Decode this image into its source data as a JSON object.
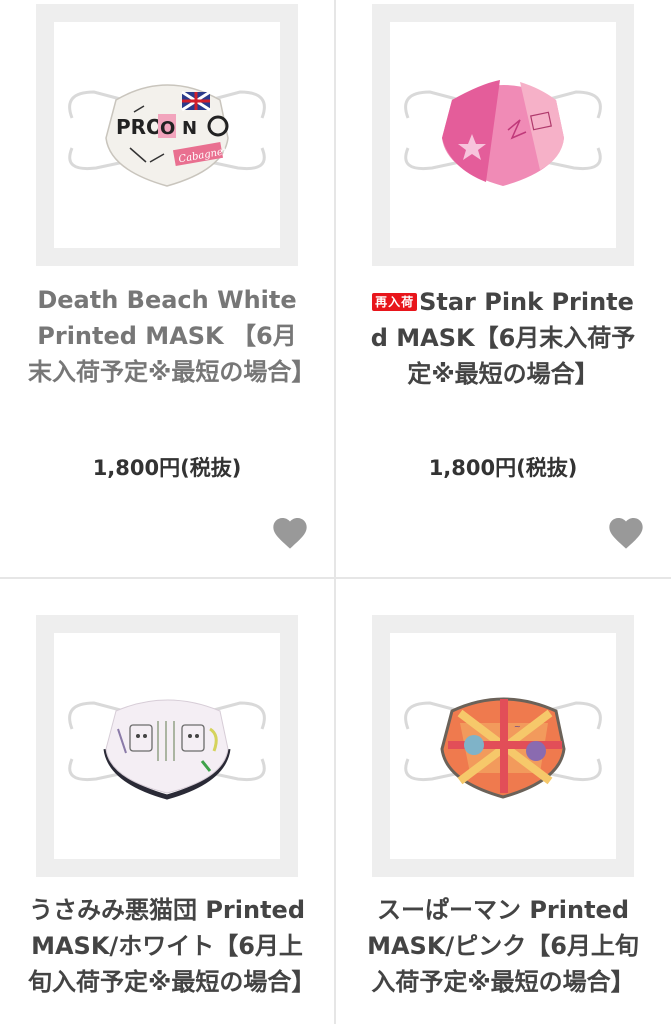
{
  "colors": {
    "divider": "#e6e6e6",
    "frame": "#eeeeee",
    "heart": "#999999",
    "badge": "#e8151b"
  },
  "products": [
    {
      "badge": "",
      "title": "Death Beach White Printed MASK 【6月末入荷予定※最短の場合】",
      "price": "1,800円(税抜)",
      "image_text": "Cabagneta",
      "favorite_icon": "heart-icon"
    },
    {
      "badge": "再入荷",
      "title": "Star Pink Printed MASK【6月末入荷予定※最短の場合】",
      "price": "1,800円(税抜)",
      "favorite_icon": "heart-icon"
    },
    {
      "badge": "",
      "title": "うさみみ悪猫団 Printed MASK/ホワイト【6月上旬入荷予定※最短の場合】",
      "price": ""
    },
    {
      "badge": "",
      "title": "スーぱーマン Printed MASK/ピンク【6月上旬入荷予定※最短の場合】",
      "price": ""
    }
  ]
}
